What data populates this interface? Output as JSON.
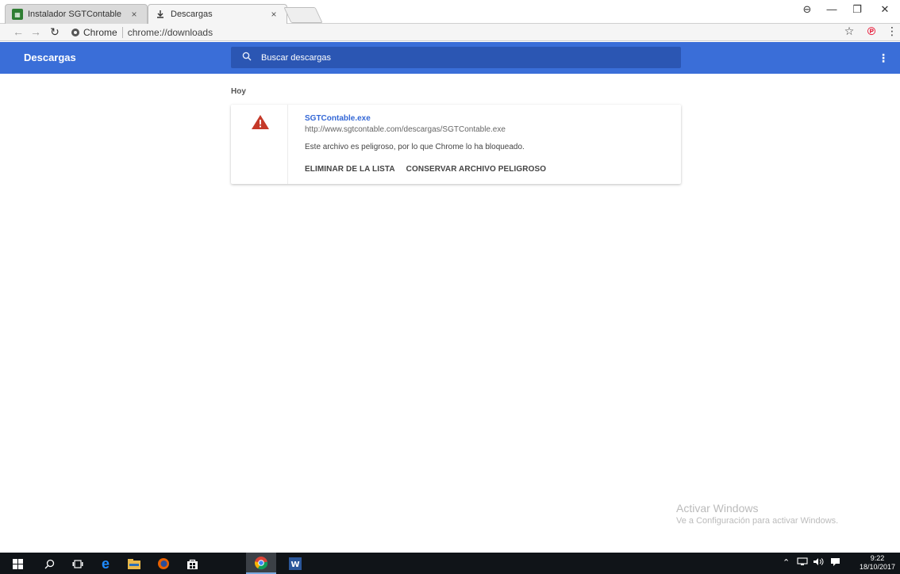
{
  "tabs": [
    {
      "title": "Instalador SGTContable",
      "close": "×",
      "icon": "sgtcontable-favicon"
    },
    {
      "title": "Descargas",
      "close": "×",
      "icon": "download-icon"
    }
  ],
  "window_controls": {
    "profile": "⊖",
    "minimize": "—",
    "restore": "❐",
    "close": "✕"
  },
  "omnibox": {
    "chip_label": "Chrome",
    "url": "chrome://downloads"
  },
  "toolbar_right": {
    "star": "☆",
    "pinterest": "℗",
    "menu": "⋮"
  },
  "header": {
    "title": "Descargas",
    "search_placeholder": "Buscar descargas",
    "menu": "⋮"
  },
  "downloads": {
    "date_label": "Hoy",
    "item": {
      "filename": "SGTContable.exe",
      "url": "http://www.sgtcontable.com/descargas/SGTContable.exe",
      "message": "Este archivo es peligroso, por lo que Chrome lo ha bloqueado.",
      "remove_label": "ELIMINAR DE LA LISTA",
      "keep_label": "CONSERVAR ARCHIVO PELIGROSO"
    }
  },
  "watermark": {
    "line1": "Activar Windows",
    "line2": "Ve a Configuración para activar Windows."
  },
  "taskbar": {
    "time": "9:22",
    "date": "18/10/2017"
  },
  "colors": {
    "header_bg": "#3a6ed8",
    "search_bg": "#2b56b3",
    "link": "#3367d6",
    "warning": "#c53929"
  }
}
